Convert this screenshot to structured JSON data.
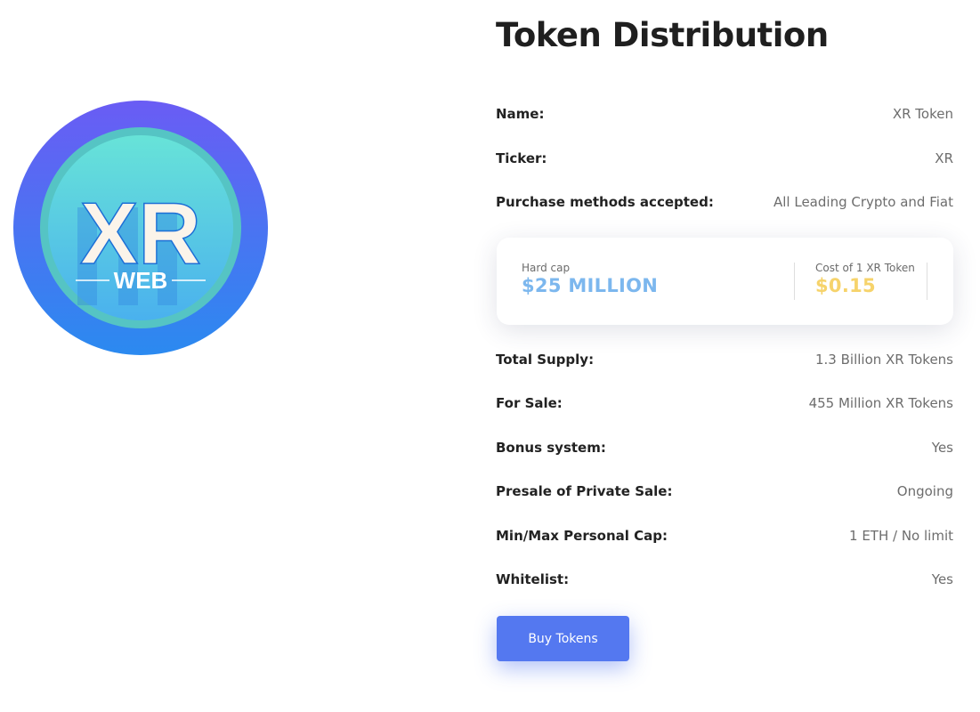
{
  "logo": {
    "text_main": "XR",
    "text_sub": "WEB"
  },
  "section": {
    "title": "Token Distribution"
  },
  "details_top": [
    {
      "label": "Name:",
      "value": "XR Token"
    },
    {
      "label": "Ticker:",
      "value": "XR"
    },
    {
      "label": "Purchase methods accepted:",
      "value": "All Leading Crypto and Fiat"
    }
  ],
  "stats_card": {
    "hard_cap_label": "Hard cap",
    "hard_cap_value": "$25 MILLION",
    "cost_label": "Cost of 1 XR Token",
    "cost_value": "$0.15",
    "colors": {
      "hard_cap": "#7cb7ee",
      "cost": "#f6d36b"
    }
  },
  "details_bottom": [
    {
      "label": "Total Supply:",
      "value": "1.3 Billion XR Tokens"
    },
    {
      "label": "For Sale:",
      "value": "455 Million XR Tokens"
    },
    {
      "label": "Bonus system:",
      "value": "Yes"
    },
    {
      "label": "Presale of Private Sale:",
      "value": "Ongoing"
    },
    {
      "label": "Min/Max Personal Cap:",
      "value": "1 ETH / No limit"
    },
    {
      "label": "Whitelist:",
      "value": "Yes"
    }
  ],
  "actions": {
    "buy_label": "Buy Tokens",
    "button_color": "#5478f0"
  }
}
